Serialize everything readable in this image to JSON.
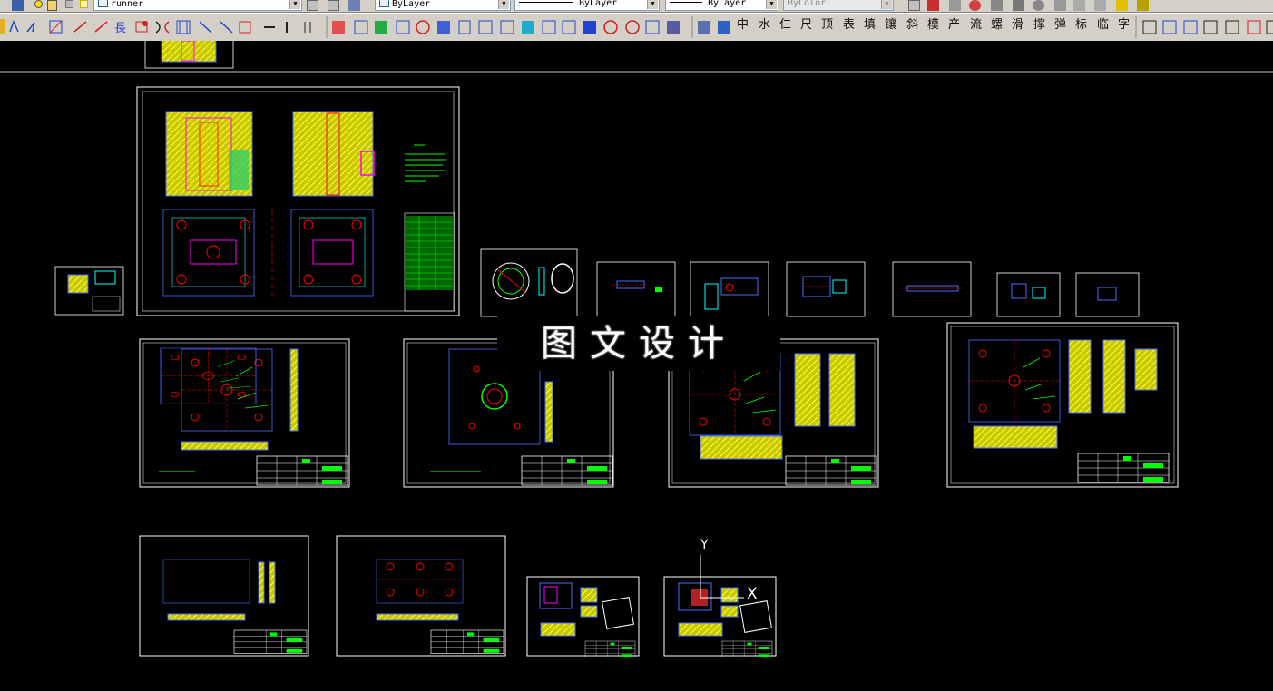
{
  "toolbar_top": {
    "layer_name": "runner",
    "color_value": "ByLayer",
    "linetype_value": "ByLayer",
    "lineweight_value": "ByLayer",
    "plotstyle_value": "ByColor"
  },
  "toolbar_dim": {
    "buttons": [
      "中",
      "水",
      "仁",
      "尺",
      "顶",
      "表",
      "填",
      "镶",
      "斜",
      "模",
      "产",
      "流",
      "螺",
      "滑",
      "撑",
      "弹",
      "标",
      "临",
      "字"
    ]
  },
  "watermark": {
    "text": "图文设计"
  },
  "ucs": {
    "y_label": "Y",
    "x_label": "X"
  },
  "colors": {
    "background": "#000000",
    "frame": "#ffffff",
    "hatch": "#ffff00",
    "table": "#00ff00",
    "magenta": "#ff00ff",
    "cyan": "#00ffff",
    "red": "#ff0000",
    "blue": "#4a6cff"
  }
}
